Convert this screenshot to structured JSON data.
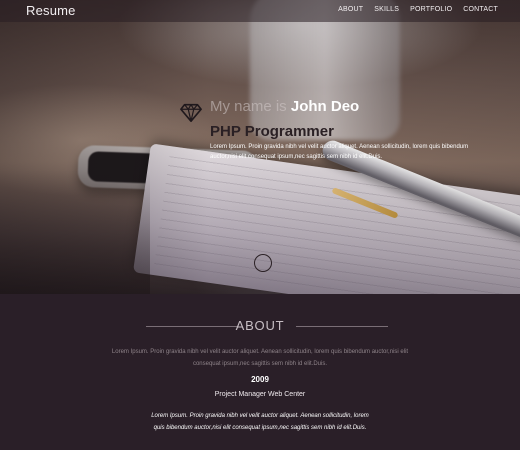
{
  "nav": {
    "brand": "Resume",
    "links": [
      "ABOUT",
      "SKILLS",
      "PORTFOLIO",
      "CONTACT"
    ]
  },
  "hero": {
    "intro_prefix": "My name is ",
    "name": "John Deo",
    "role": "PHP Programmer",
    "description": "Lorem Ipsum. Proin gravida nibh vel velit auctor aliquet. Aenean sollicitudin, lorem quis bibendum auctor,nisi elit consequat ipsum,nec sagittis sem nibh id elit.Duis.",
    "icon": "diamond-icon"
  },
  "about": {
    "heading": "ABOUT",
    "text": "Lorem Ipsum. Proin gravida nibh vel velit auctor aliquet. Aenean sollicitudin, lorem quis bibendum auctor,nisi elit consequat ipsum,nec sagittis sem nibh id elit.Duis.",
    "year": "2009",
    "job_title": "Project Manager Web Center",
    "job_desc": "Lorem Ipsum. Proin gravida nibh vel velit auctor aliquet. Aenean sollicitudin, lorem quis bibendum auctor,nisi elit consequat ipsum,nec sagittis sem nibh id elit.Duis."
  },
  "colors": {
    "about_background": "#2a1f28",
    "nav_text": "#f2eef0",
    "role_text": "#2a2024"
  }
}
